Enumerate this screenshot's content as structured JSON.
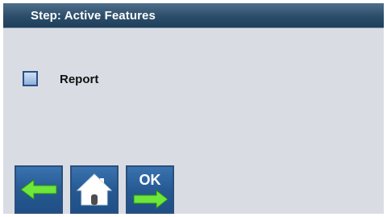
{
  "header": {
    "title": "Step: Active Features"
  },
  "options": {
    "report": {
      "label": "Report",
      "checked": false
    }
  },
  "buttons": {
    "back_icon": "left-arrow-icon",
    "home_icon": "home-icon",
    "ok_label": "OK",
    "ok_icon": "right-arrow-icon"
  },
  "colors": {
    "header": "#2c4d69",
    "background": "#d9dde3",
    "button": "#265a93",
    "arrow": "#6ee63a"
  }
}
